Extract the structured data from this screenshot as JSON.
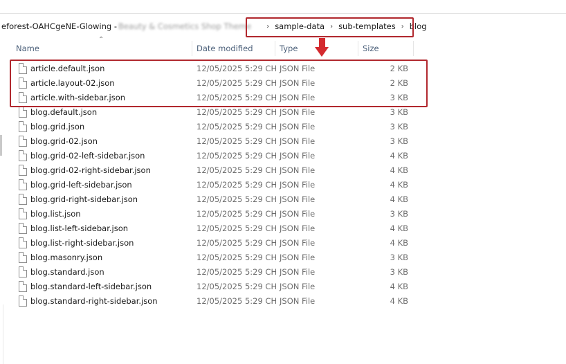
{
  "address_bar": {
    "folder_prefix": "eforest-OAHCgeNE-Glowing - ",
    "folder_blurred": "Beauty & Cosmetics Shop Theme",
    "separator_icon": "chevron-right-icon",
    "crumbs": [
      "sample-data",
      "sub-templates",
      "blog"
    ]
  },
  "columns": {
    "name": "Name",
    "modified": "Date modified",
    "type": "Type",
    "size": "Size",
    "sort_icon": "sort-up-icon"
  },
  "files": [
    {
      "name": "article.default.json",
      "modified": "12/05/2025 5:29 CH",
      "type": "JSON File",
      "size": "2 KB",
      "highlighted": true
    },
    {
      "name": "article.layout-02.json",
      "modified": "12/05/2025 5:29 CH",
      "type": "JSON File",
      "size": "2 KB",
      "highlighted": true
    },
    {
      "name": "article.with-sidebar.json",
      "modified": "12/05/2025 5:29 CH",
      "type": "JSON File",
      "size": "3 KB",
      "highlighted": true
    },
    {
      "name": "blog.default.json",
      "modified": "12/05/2025 5:29 CH",
      "type": "JSON File",
      "size": "3 KB"
    },
    {
      "name": "blog.grid.json",
      "modified": "12/05/2025 5:29 CH",
      "type": "JSON File",
      "size": "3 KB"
    },
    {
      "name": "blog.grid-02.json",
      "modified": "12/05/2025 5:29 CH",
      "type": "JSON File",
      "size": "3 KB"
    },
    {
      "name": "blog.grid-02-left-sidebar.json",
      "modified": "12/05/2025 5:29 CH",
      "type": "JSON File",
      "size": "4 KB"
    },
    {
      "name": "blog.grid-02-right-sidebar.json",
      "modified": "12/05/2025 5:29 CH",
      "type": "JSON File",
      "size": "4 KB"
    },
    {
      "name": "blog.grid-left-sidebar.json",
      "modified": "12/05/2025 5:29 CH",
      "type": "JSON File",
      "size": "4 KB"
    },
    {
      "name": "blog.grid-right-sidebar.json",
      "modified": "12/05/2025 5:29 CH",
      "type": "JSON File",
      "size": "4 KB"
    },
    {
      "name": "blog.list.json",
      "modified": "12/05/2025 5:29 CH",
      "type": "JSON File",
      "size": "3 KB"
    },
    {
      "name": "blog.list-left-sidebar.json",
      "modified": "12/05/2025 5:29 CH",
      "type": "JSON File",
      "size": "4 KB"
    },
    {
      "name": "blog.list-right-sidebar.json",
      "modified": "12/05/2025 5:29 CH",
      "type": "JSON File",
      "size": "4 KB"
    },
    {
      "name": "blog.masonry.json",
      "modified": "12/05/2025 5:29 CH",
      "type": "JSON File",
      "size": "3 KB"
    },
    {
      "name": "blog.standard.json",
      "modified": "12/05/2025 5:29 CH",
      "type": "JSON File",
      "size": "3 KB"
    },
    {
      "name": "blog.standard-left-sidebar.json",
      "modified": "12/05/2025 5:29 CH",
      "type": "JSON File",
      "size": "4 KB"
    },
    {
      "name": "blog.standard-right-sidebar.json",
      "modified": "12/05/2025 5:29 CH",
      "type": "JSON File",
      "size": "4 KB"
    }
  ],
  "file_icon": "file-icon",
  "annotations": {
    "highlight_color": "#b1282e",
    "arrow_color": "#d42a2f",
    "arrow_icon": "arrow-down-icon"
  }
}
